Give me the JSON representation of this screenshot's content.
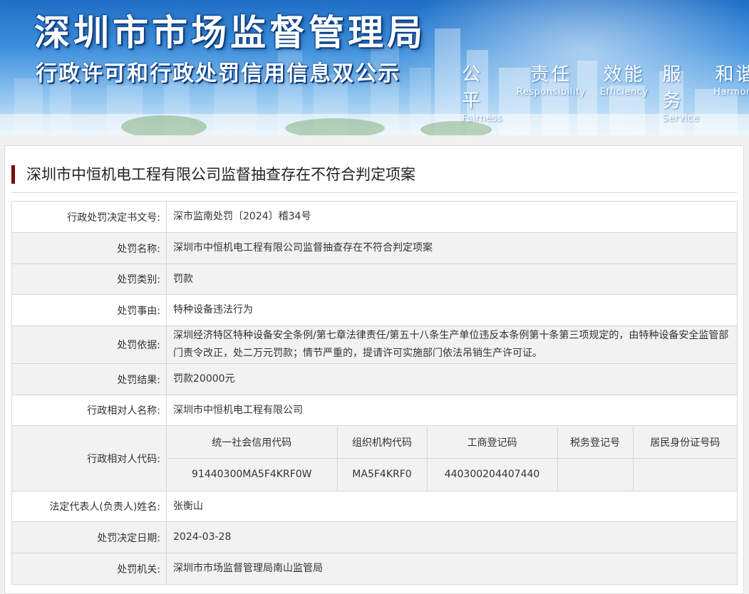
{
  "banner": {
    "title_main": "深圳市市场监督管理局",
    "title_sub": "行政许可和行政处罚信用信息双公示",
    "motto": [
      {
        "cn": "公平",
        "en": "Fairness"
      },
      {
        "cn": "责任",
        "en": "Responsibility"
      },
      {
        "cn": "效能",
        "en": "Efficiency"
      },
      {
        "cn": "服务",
        "en": "Service"
      },
      {
        "cn": "和谐",
        "en": "Harmony"
      }
    ]
  },
  "page": {
    "title": "深圳市中恒机电工程有限公司监督抽查存在不符合判定项案",
    "accent_color": "#7a0c10"
  },
  "record": {
    "decision_no": {
      "label": "行政处罚决定书文号:",
      "value": "深市监南处罚〔2024〕稽34号"
    },
    "case_name": {
      "label": "处罚名称:",
      "value": "深圳市中恒机电工程有限公司监督抽查存在不符合判定项案"
    },
    "category": {
      "label": "处罚类别:",
      "value": "罚款"
    },
    "reason": {
      "label": "处罚事由:",
      "value": "特种设备违法行为"
    },
    "basis": {
      "label": "处罚依据:",
      "value": "深圳经济特区特种设备安全条例/第七章法律责任/第五十八条生产单位违反本条例第十条第三项规定的，由特种设备安全监管部门责令改正，处二万元罚款；情节严重的，提请许可实施部门依法吊销生产许可证。"
    },
    "result": {
      "label": "处罚结果:",
      "value": "罚款20000元"
    },
    "party_name": {
      "label": "行政相对人名称:",
      "value": "深圳市中恒机电工程有限公司"
    },
    "party_code": {
      "label": "行政相对人代码:",
      "headers": [
        "统一社会信用代码",
        "组织机构代码",
        "工商登记码",
        "税务登记号",
        "居民身份证号码"
      ],
      "values": [
        "91440300MA5F4KRF0W",
        "MA5F4KRF0",
        "440300204407440",
        "",
        ""
      ]
    },
    "legal_rep": {
      "label": "法定代表人(负责人)姓名:",
      "value": "张衡山"
    },
    "decision_date": {
      "label": "处罚决定日期:",
      "value": "2024-03-28"
    },
    "authority": {
      "label": "处罚机关:",
      "value": "深圳市市场监督管理局南山监管局"
    }
  }
}
